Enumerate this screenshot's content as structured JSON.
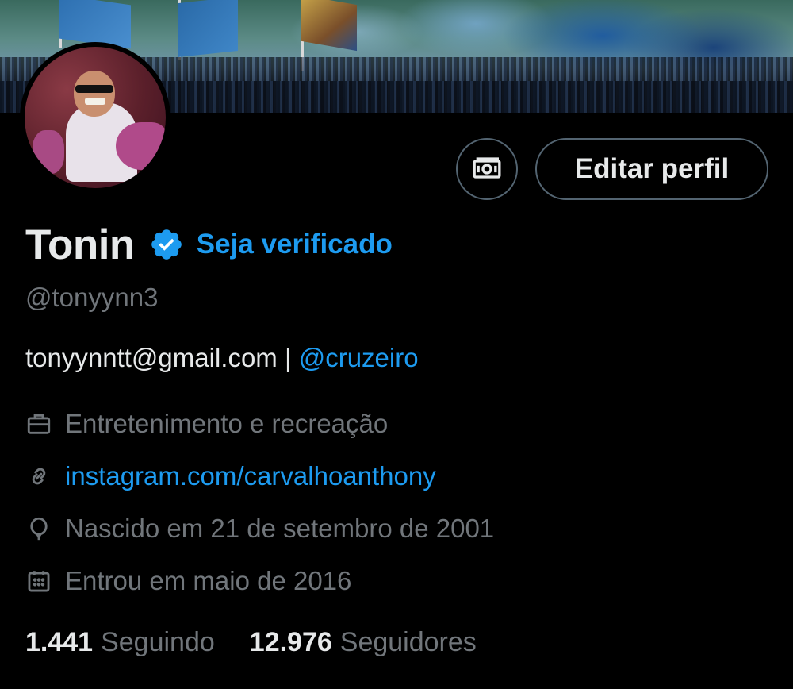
{
  "profile": {
    "display_name": "Tonin",
    "get_verified_label": "Seja verificado",
    "handle": "@tonyynn3",
    "bio_text": "tonyynntt@gmail.com",
    "bio_separator": " | ",
    "bio_mention": "@cruzeiro",
    "category": "Entretenimento e recreação",
    "website": "instagram.com/carvalhoanthony",
    "birthdate": "Nascido em 21 de setembro de 2001",
    "joined": "Entrou em maio de 2016"
  },
  "buttons": {
    "edit_profile_label": "Editar perfil",
    "tip_icon": "money-icon"
  },
  "stats": {
    "following_count": "1.441",
    "following_label": "Seguindo",
    "followers_count": "12.976",
    "followers_label": "Seguidores"
  },
  "icons": {
    "verified": "verified-badge-icon",
    "category": "briefcase-icon",
    "website": "link-icon",
    "birthdate": "balloon-icon",
    "joined": "calendar-icon"
  },
  "colors": {
    "background": "#000000",
    "accent": "#1d9bf0",
    "primary_text": "#e7e9ea",
    "secondary_text": "#71767b",
    "border": "#536471"
  }
}
